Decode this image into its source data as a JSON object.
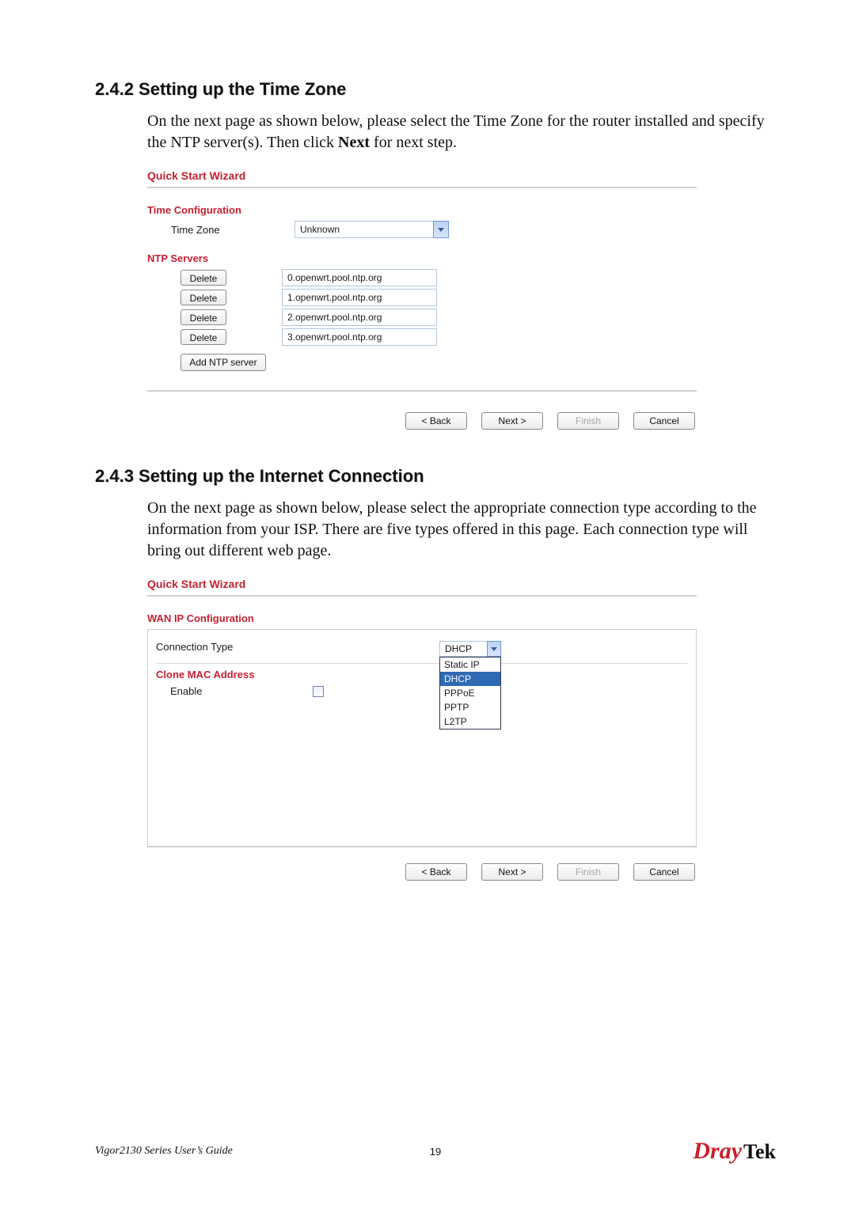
{
  "sections": {
    "s1": {
      "heading": "2.4.2 Setting up the Time Zone",
      "para_a": "On the next page as shown below, please select the Time Zone for the router installed and specify the NTP server(s). Then click ",
      "para_b": "Next",
      "para_c": " for next step."
    },
    "s2": {
      "heading": "2.4.3 Setting up the Internet Connection",
      "para": "On the next page as shown below, please select the appropriate connection type according to the information from your ISP. There are five types offered in this page. Each connection type will bring out different web page."
    }
  },
  "wizard1": {
    "title": "Quick Start Wizard",
    "section": "Time Configuration",
    "tz_label": "Time Zone",
    "tz_value": "Unknown",
    "ntp_heading": "NTP Servers",
    "delete_label": "Delete",
    "servers": [
      "0.openwrt.pool.ntp.org",
      "1.openwrt.pool.ntp.org",
      "2.openwrt.pool.ntp.org",
      "3.openwrt.pool.ntp.org"
    ],
    "add_label": "Add NTP server",
    "buttons": {
      "back": "< Back",
      "next": "Next >",
      "finish": "Finish",
      "cancel": "Cancel"
    }
  },
  "wizard2": {
    "title": "Quick Start Wizard",
    "section": "WAN IP Configuration",
    "conn_label": "Connection Type",
    "conn_value": "DHCP",
    "conn_options": {
      "o0": "Static IP",
      "o1": "DHCP",
      "o2": "PPPoE",
      "o3": "PPTP",
      "o4": "L2TP"
    },
    "clone_heading": "Clone MAC Address",
    "enable_label": "Enable",
    "buttons": {
      "back": "< Back",
      "next": "Next >",
      "finish": "Finish",
      "cancel": "Cancel"
    }
  },
  "footer": {
    "guide": "Vigor2130 Series User’s Guide",
    "page": "19",
    "brand_a": "Dray",
    "brand_b": "Tek"
  }
}
